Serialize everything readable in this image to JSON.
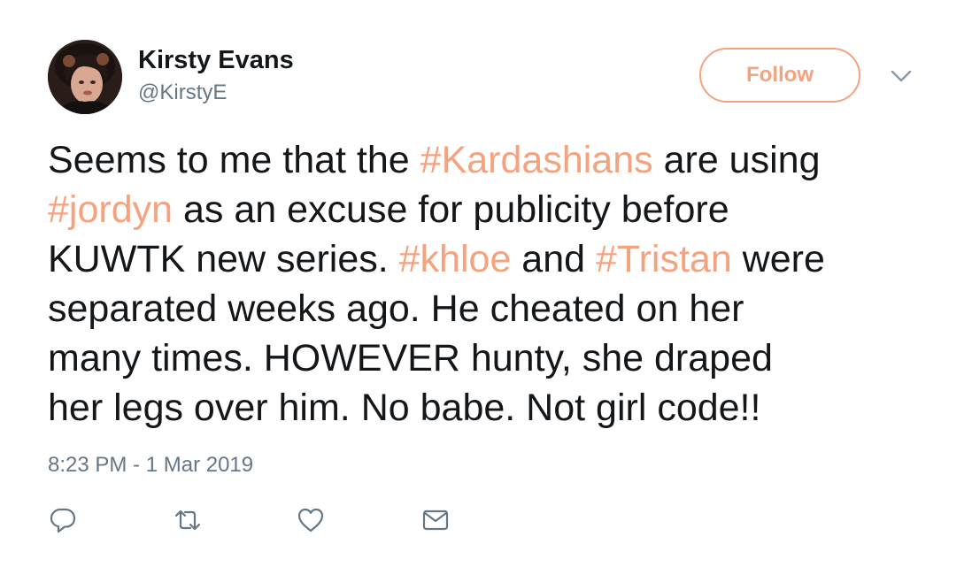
{
  "user": {
    "name": "Kirsty Evans",
    "handle": "@KirstyE"
  },
  "follow_button": {
    "label": "Follow"
  },
  "tweet": {
    "lines": [
      [
        {
          "t": "Seems to me that the ",
          "h": false
        },
        {
          "t": "#Kardashians",
          "h": true
        },
        {
          "t": " are using",
          "h": false
        }
      ],
      [
        {
          "t": "#jordyn",
          "h": true
        },
        {
          "t": " as an excuse for publicity before",
          "h": false
        }
      ],
      [
        {
          "t": "KUWTK new series. ",
          "h": false
        },
        {
          "t": "#khloe",
          "h": true
        },
        {
          "t": " and ",
          "h": false
        },
        {
          "t": "#Tristan",
          "h": true
        },
        {
          "t": " were",
          "h": false
        }
      ],
      [
        {
          "t": "separated weeks ago. He cheated on her",
          "h": false
        }
      ],
      [
        {
          "t": "many times. HOWEVER hunty, she draped",
          "h": false
        }
      ],
      [
        {
          "t": "her legs over him. No babe. Not girl code!!",
          "h": false
        }
      ]
    ],
    "timestamp": "8:23 PM - 1 Mar 2019"
  },
  "actions": {
    "icons": [
      "reply-icon",
      "retweet-icon",
      "like-icon",
      "dm-icon"
    ]
  },
  "colors": {
    "accent": "#f5a27e",
    "text": "#14171a",
    "muted": "#657786"
  }
}
